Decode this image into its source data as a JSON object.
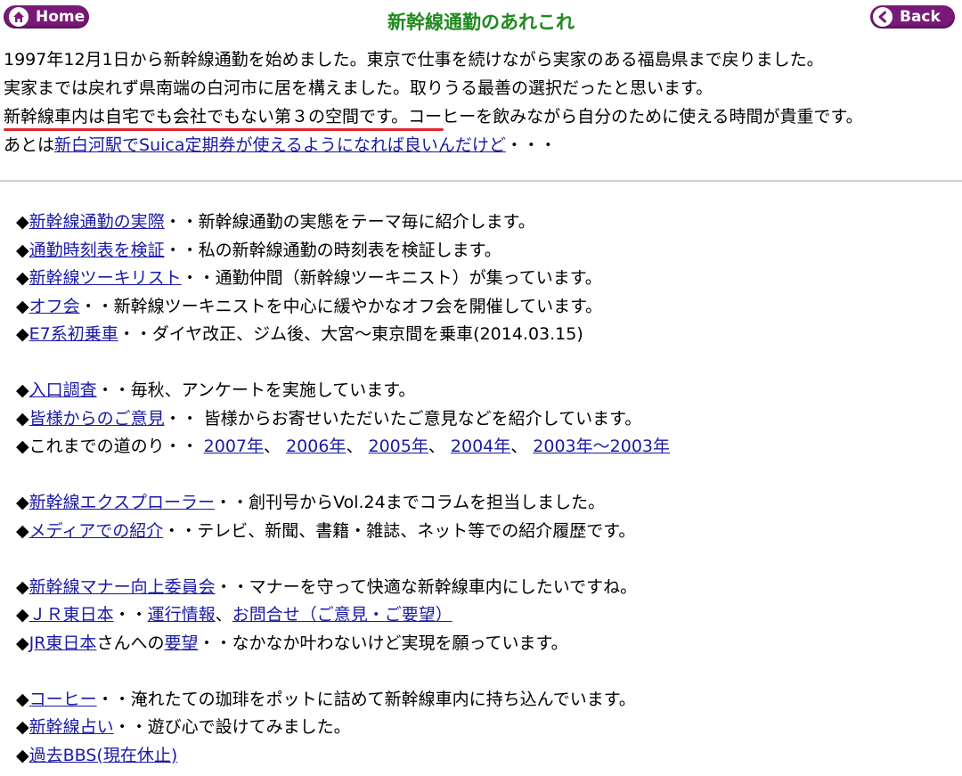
{
  "header": {
    "home_label": "Home",
    "back_label": "Back",
    "title": "新幹線通勤のあれこれ",
    "pill_color": "#7a1a78",
    "title_color": "#1f8a1f"
  },
  "intro": {
    "line1": "1997年12月1日から新幹線通勤を始めました。東京で仕事を続けながら実家のある福島県まで戻りました。",
    "line2": "実家までは戻れず県南端の白河市に居を構えました。取りうる最善の選択だったと思います。",
    "line3": "新幹線車内は自宅でも会社でもない第３の空間です。コーヒーを飲みながら自分のために使える時間が貴重です。",
    "line4_pre": "あとは",
    "line4_link": "新白河駅でSuica定期券が使えるようになれば良いんだけど",
    "line4_post": "・・・"
  },
  "bullet": "◆",
  "items": {
    "jissai": {
      "link": "新幹線通勤の実際",
      "desc": "・・新幹線通勤の実態をテーマ毎に紹介します。"
    },
    "jikoku": {
      "link": "通勤時刻表を検証",
      "desc": "・・私の新幹線通勤の時刻表を検証します。"
    },
    "tourist": {
      "link": "新幹線ツーキリスト",
      "desc": "・・通勤仲間（新幹線ツーキニスト）が集っています。"
    },
    "offkai": {
      "link": "オフ会",
      "desc": "・・新幹線ツーキニストを中心に緩やかなオフ会を開催しています。"
    },
    "e7": {
      "link": "E7系初乗車",
      "desc": "・・ダイヤ改正、ジム後、大宮～東京間を乗車(2014.03.15)"
    },
    "iriguchi": {
      "link": "入口調査",
      "desc": "・・毎秋、アンケートを実施しています。"
    },
    "goiken": {
      "link": "皆様からのご意見",
      "desc": "・・ 皆様からお寄せいただいたご意見などを紹介しています。"
    },
    "michinori": {
      "text": "これまでの道のり・・ ",
      "years": [
        "2007年",
        "2006年",
        "2005年",
        "2004年",
        "2003年～2003年"
      ],
      "sep": "、 "
    },
    "explorer": {
      "link": "新幹線エクスプローラー",
      "desc": "・・創刊号からVol.24までコラムを担当しました。"
    },
    "media": {
      "link": "メディアでの紹介",
      "desc": "・・テレビ、新聞、書籍・雑誌、ネット等での紹介履歴です。"
    },
    "manner": {
      "link": "新幹線マナー向上委員会",
      "desc": "・・マナーを守って快適な新幹線車内にしたいですね。"
    },
    "jr": {
      "link": "ＪＲ東日本",
      "sep1": "・・",
      "unko": "運行情報",
      "sep2": "、",
      "toiawase": "お問合せ（ご意見・ご要望）"
    },
    "youbou": {
      "link1": "JR東日本",
      "mid": "さんへの",
      "link2": "要望",
      "desc": "・・なかなか叶わないけど実現を願っています。"
    },
    "coffee": {
      "link": "コーヒー",
      "desc": "・・淹れたての珈琲をポットに詰めて新幹線車内に持ち込んでいます。"
    },
    "uranai": {
      "link": "新幹線占い",
      "desc": "・・遊び心で設けてみました。"
    },
    "bbs": {
      "link": "過去BBS(現在休止)"
    }
  }
}
